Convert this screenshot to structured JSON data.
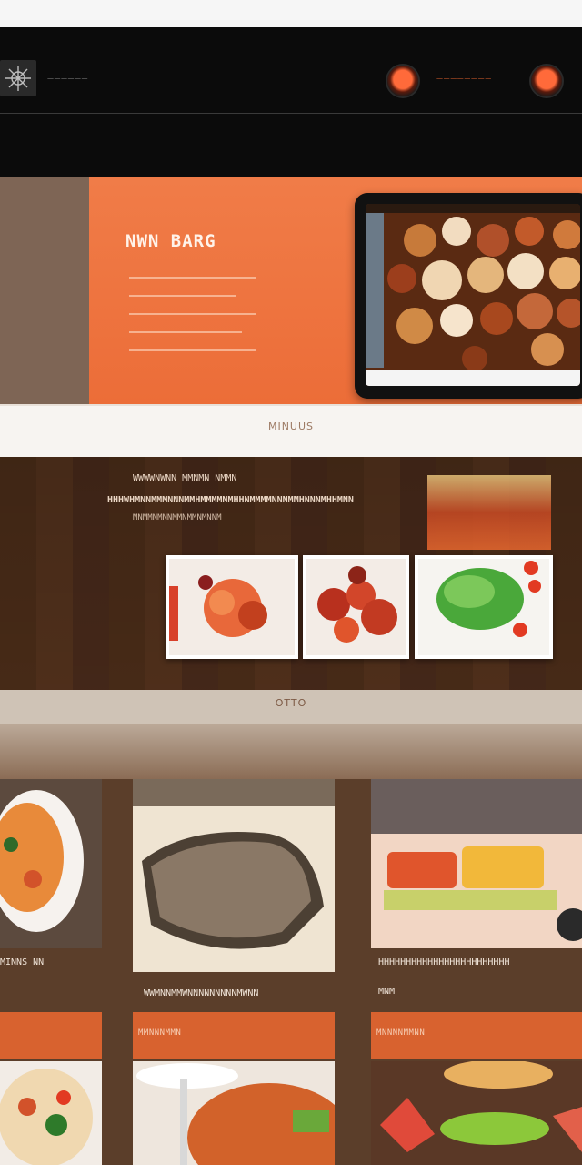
{
  "header": {
    "brand_tag": "——————",
    "link_text": "————————",
    "nav": [
      "—",
      "———",
      "———",
      "————",
      "—————",
      "—————"
    ]
  },
  "hero": {
    "title": "NWN BARG",
    "lines": [
      "—————————",
      "——————————",
      "—————————",
      "————————————",
      "——————————"
    ]
  },
  "band1": {
    "text": "MINUUS"
  },
  "wood": {
    "line1": "WWWWNWNN MMNMN NMMN",
    "line2": "HHHWHMNNMMMNNNMMHMMMMNMHHNMMMMNNNMMHNNNMHHMNN",
    "line3": "MNMMNMNNMMNMMNMNNM"
  },
  "band2": {
    "text": "OTTO"
  },
  "grid": {
    "caption1": "MINNS NN",
    "caption2": "WWMNNMMWNNNNNNNNNMWNN",
    "caption3": "HHHHHHHHHHHHHHHHHHHHHHHH",
    "caption3b": "MNM",
    "orange1": "",
    "orange2": "MMNNNMMN",
    "orange3": "MNNNNMMNN"
  },
  "colors": {
    "accent": "#ec6d38",
    "header_bg": "#0b0b0b",
    "wood": "#4a2c18"
  }
}
